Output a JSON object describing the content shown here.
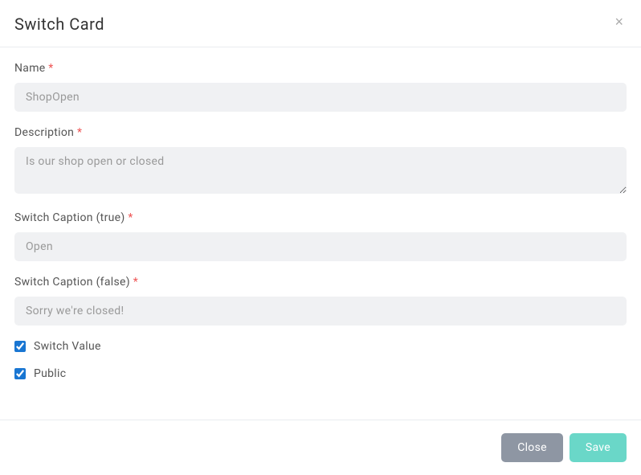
{
  "header": {
    "title": "Switch Card",
    "close_symbol": "×"
  },
  "fields": {
    "name": {
      "label": "Name",
      "required_mark": "*",
      "value": "ShopOpen"
    },
    "description": {
      "label": "Description",
      "required_mark": "*",
      "value": "Is our shop open or closed"
    },
    "caption_true": {
      "label": "Switch Caption (true)",
      "required_mark": "*",
      "value": "Open"
    },
    "caption_false": {
      "label": "Switch Caption (false)",
      "required_mark": "*",
      "value": "Sorry we're closed!"
    },
    "switch_value": {
      "label": "Switch Value",
      "checked": true
    },
    "public": {
      "label": "Public",
      "checked": true
    }
  },
  "footer": {
    "close_label": "Close",
    "save_label": "Save"
  }
}
